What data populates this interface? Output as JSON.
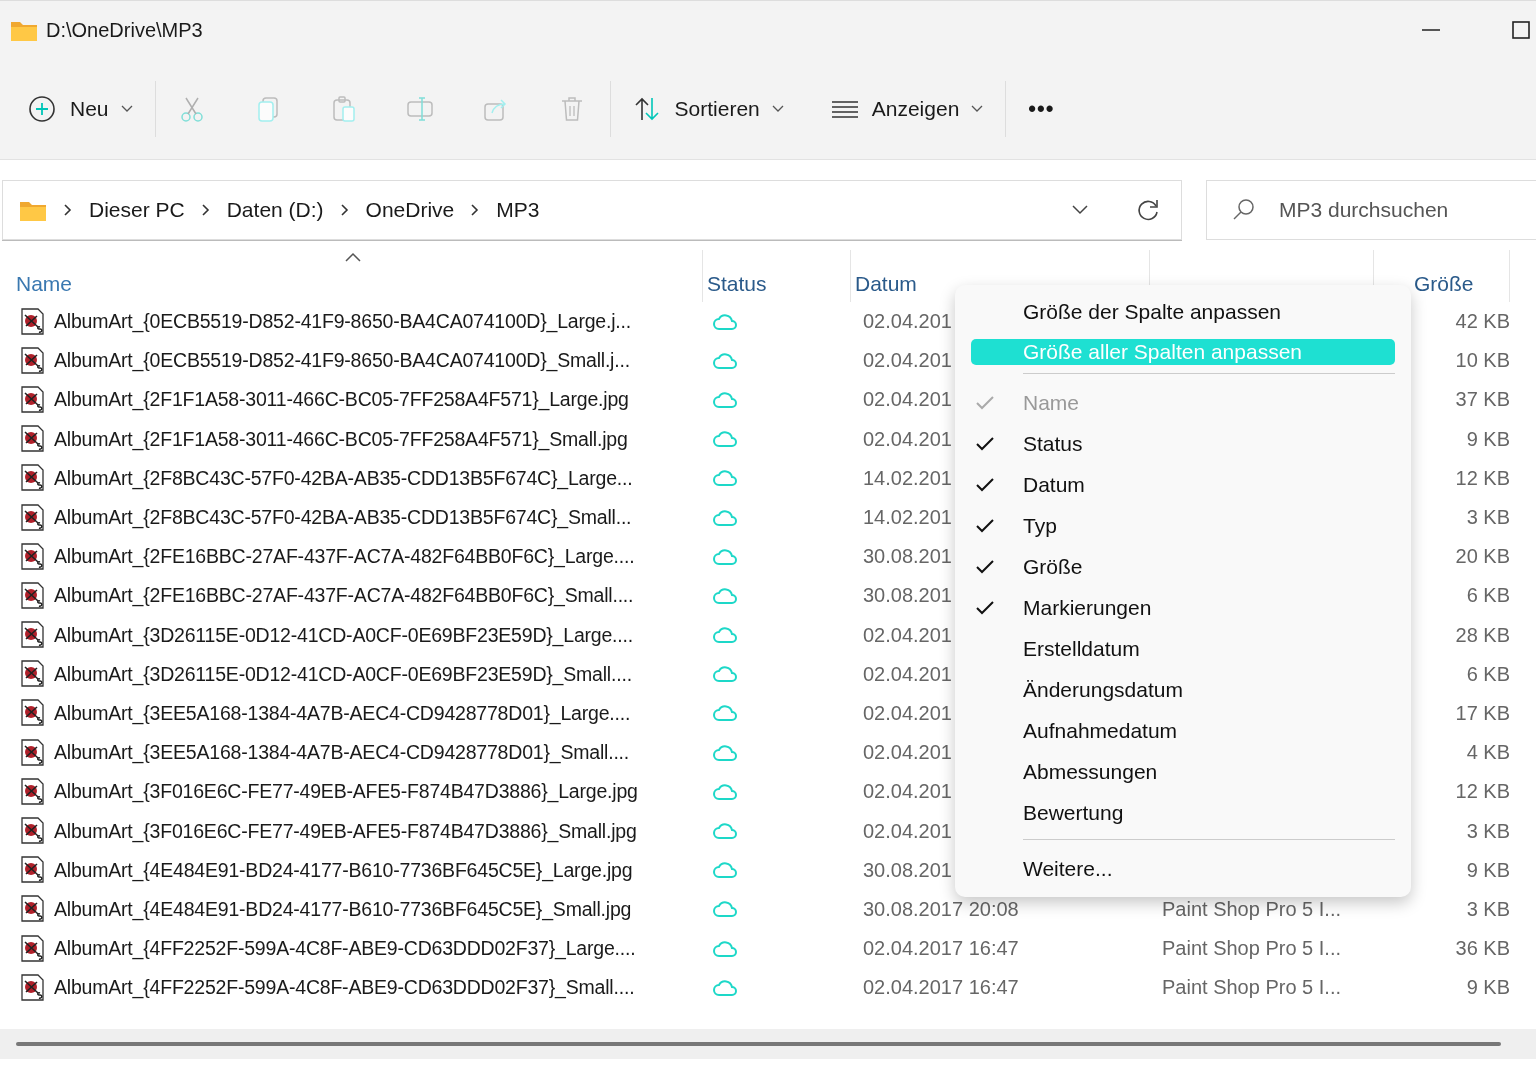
{
  "window": {
    "title": "D:\\OneDrive\\MP3"
  },
  "toolbar": [
    [
      {
        "kind": "new",
        "label": "Neu",
        "dropdown": true
      }
    ],
    [
      {
        "kind": "cut",
        "disabled": true
      },
      {
        "kind": "copy",
        "disabled": true
      },
      {
        "kind": "paste",
        "disabled": true
      },
      {
        "kind": "rename",
        "disabled": true
      },
      {
        "kind": "share",
        "disabled": true
      },
      {
        "kind": "delete",
        "disabled": true
      }
    ],
    [
      {
        "kind": "sort",
        "label": "Sortieren",
        "dropdown": true
      },
      {
        "kind": "view",
        "label": "Anzeigen",
        "dropdown": true
      }
    ],
    [
      {
        "kind": "more",
        "label": "•••"
      }
    ]
  ],
  "address": {
    "breadcrumbs": [
      "Dieser PC",
      "Daten (D:)",
      "OneDrive",
      "MP3"
    ]
  },
  "search": {
    "placeholder": "MP3 durchsuchen"
  },
  "table": {
    "columns": [
      {
        "label": "Name",
        "sorted": true
      },
      {
        "label": "Status",
        "sorted": false
      },
      {
        "label": "Datum",
        "sorted": false
      },
      {
        "sorted": false
      },
      {
        "label": "Größe",
        "sorted": false
      }
    ],
    "rows": [
      {
        "name": "AlbumArt_{0ECB5519-D852-41F9-8650-BA4CA074100D}_Large.j...",
        "date": "02.04.201",
        "size": "42 KB"
      },
      {
        "name": "AlbumArt_{0ECB5519-D852-41F9-8650-BA4CA074100D}_Small.j...",
        "date": "02.04.201",
        "size": "10 KB"
      },
      {
        "name": "AlbumArt_{2F1F1A58-3011-466C-BC05-7FF258A4F571}_Large.jpg",
        "date": "02.04.201",
        "size": "37 KB"
      },
      {
        "name": "AlbumArt_{2F1F1A58-3011-466C-BC05-7FF258A4F571}_Small.jpg",
        "date": "02.04.201",
        "size": "9 KB"
      },
      {
        "name": "AlbumArt_{2F8BC43C-57F0-42BA-AB35-CDD13B5F674C}_Large...",
        "date": "14.02.201",
        "size": "12 KB"
      },
      {
        "name": "AlbumArt_{2F8BC43C-57F0-42BA-AB35-CDD13B5F674C}_Small...",
        "date": "14.02.201",
        "size": "3 KB"
      },
      {
        "name": "AlbumArt_{2FE16BBC-27AF-437F-AC7A-482F64BB0F6C}_Large....",
        "date": "30.08.201",
        "size": "20 KB"
      },
      {
        "name": "AlbumArt_{2FE16BBC-27AF-437F-AC7A-482F64BB0F6C}_Small....",
        "date": "30.08.201",
        "size": "6 KB"
      },
      {
        "name": "AlbumArt_{3D26115E-0D12-41CD-A0CF-0E69BF23E59D}_Large....",
        "date": "02.04.201",
        "size": "28 KB"
      },
      {
        "name": "AlbumArt_{3D26115E-0D12-41CD-A0CF-0E69BF23E59D}_Small....",
        "date": "02.04.201",
        "size": "6 KB"
      },
      {
        "name": "AlbumArt_{3EE5A168-1384-4A7B-AEC4-CD9428778D01}_Large....",
        "date": "02.04.201",
        "size": "17 KB"
      },
      {
        "name": "AlbumArt_{3EE5A168-1384-4A7B-AEC4-CD9428778D01}_Small....",
        "date": "02.04.201",
        "size": "4 KB"
      },
      {
        "name": "AlbumArt_{3F016E6C-FE77-49EB-AFE5-F874B47D3886}_Large.jpg",
        "date": "02.04.201",
        "size": "12 KB"
      },
      {
        "name": "AlbumArt_{3F016E6C-FE77-49EB-AFE5-F874B47D3886}_Small.jpg",
        "date": "02.04.201",
        "size": "3 KB"
      },
      {
        "name": "AlbumArt_{4E484E91-BD24-4177-B610-7736BF645C5E}_Large.jpg",
        "date": "30.08.201",
        "size": "9 KB"
      },
      {
        "name": "AlbumArt_{4E484E91-BD24-4177-B610-7736BF645C5E}_Small.jpg",
        "date": "30.08.2017 20:08",
        "type": "Paint Shop Pro 5 I...",
        "size": "3 KB"
      },
      {
        "name": "AlbumArt_{4FF2252F-599A-4C8F-ABE9-CD63DDD02F37}_Large....",
        "date": "02.04.2017 16:47",
        "type": "Paint Shop Pro 5 I...",
        "size": "36 KB"
      },
      {
        "name": "AlbumArt_{4FF2252F-599A-4C8F-ABE9-CD63DDD02F37}_Small....",
        "date": "02.04.2017 16:47",
        "type": "Paint Shop Pro 5 I...",
        "size": "9 KB"
      }
    ]
  },
  "context_menu": {
    "items": [
      {
        "kind": "action",
        "label": "Größe der Spalte anpassen",
        "selected": false
      },
      {
        "kind": "action",
        "label": "Größe aller Spalten anpassen",
        "selected": true
      },
      {
        "kind": "column",
        "label": "Name",
        "checked": true,
        "disabled": true
      },
      {
        "kind": "column",
        "label": "Status",
        "checked": true,
        "disabled": false
      },
      {
        "kind": "column",
        "label": "Datum",
        "checked": true,
        "disabled": false
      },
      {
        "kind": "column",
        "label": "Typ",
        "checked": true,
        "disabled": false
      },
      {
        "kind": "column",
        "label": "Größe",
        "checked": true,
        "disabled": false
      },
      {
        "kind": "column",
        "label": "Markierungen",
        "checked": true,
        "disabled": false
      },
      {
        "kind": "column",
        "label": "Erstelldatum",
        "checked": false,
        "disabled": false
      },
      {
        "kind": "column",
        "label": "Änderungsdatum",
        "checked": false,
        "disabled": false
      },
      {
        "kind": "column",
        "label": "Aufnahmedatum",
        "checked": false,
        "disabled": false
      },
      {
        "kind": "column",
        "label": "Abmessungen",
        "checked": false,
        "disabled": false
      },
      {
        "kind": "column",
        "label": "Bewertung",
        "checked": false,
        "disabled": false
      },
      {
        "kind": "more",
        "label": "Weitere..."
      }
    ]
  }
}
